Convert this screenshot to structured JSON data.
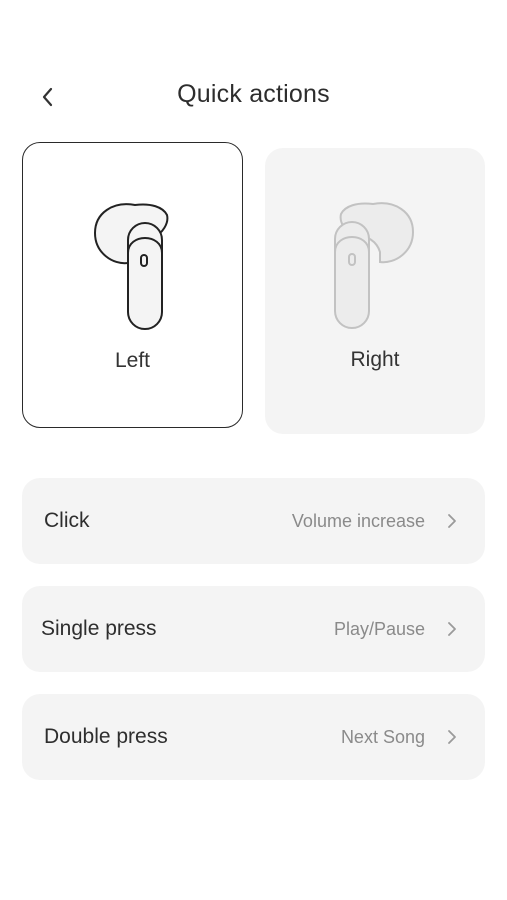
{
  "header": {
    "title": "Quick actions",
    "back_icon": "chevron-left-icon"
  },
  "earbuds": [
    {
      "label": "Left",
      "selected": true,
      "icon": "left-earbud-icon"
    },
    {
      "label": "Right",
      "selected": false,
      "icon": "right-earbud-icon"
    }
  ],
  "actions": [
    {
      "label": "Click",
      "value": "Volume increase",
      "icon": "chevron-right-icon"
    },
    {
      "label": "Single press",
      "value": "Play/Pause",
      "icon": "chevron-right-icon"
    },
    {
      "label": "Double press",
      "value": "Next Song",
      "icon": "chevron-right-icon"
    }
  ],
  "colors": {
    "selected_border": "#2a2a2a",
    "card_background": "#f4f4f4",
    "secondary_text": "#8a8a8a"
  }
}
